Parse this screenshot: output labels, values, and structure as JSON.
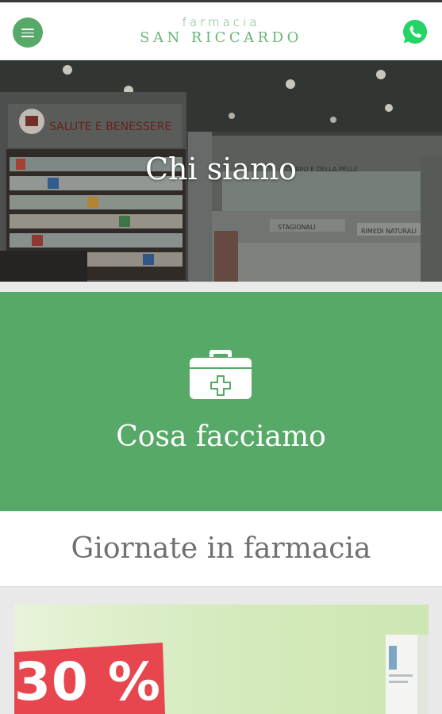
{
  "header": {
    "logo_top": "farmacia",
    "logo_bottom": "SAN RICCARDO",
    "menu_icon": "hamburger-menu-icon",
    "whatsapp_icon": "whatsapp-icon"
  },
  "hero": {
    "title": "Chi siamo",
    "sign_text": "SALUTE E BENESSERE",
    "shelf_label_1": "CORPO E DELLA PELLE",
    "shelf_label_2": "STAGIONALI",
    "shelf_label_3": "RIMEDI NATURALI"
  },
  "cosa": {
    "title": "Cosa facciamo",
    "icon": "first-aid-kit-icon"
  },
  "giornate": {
    "title": "Giornate in farmacia"
  },
  "promo": {
    "text": "30 %"
  },
  "colors": {
    "brand_green": "#57a967",
    "logo_green": "#6bb577",
    "whatsapp_green": "#25d366",
    "promo_red": "#e8464e"
  }
}
